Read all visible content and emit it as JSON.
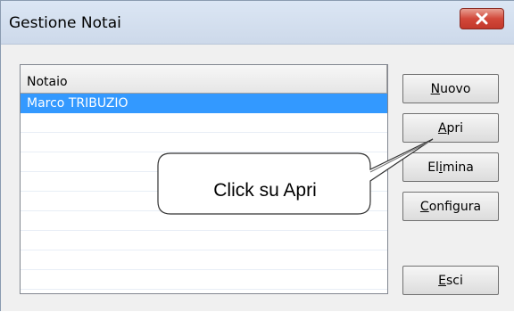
{
  "window": {
    "title": "Gestione Notai",
    "close_icon": "close-icon"
  },
  "list": {
    "column_header": "Notaio",
    "rows": [
      {
        "label": "Marco TRIBUZIO",
        "selected": true
      },
      {
        "label": ""
      },
      {
        "label": ""
      },
      {
        "label": ""
      },
      {
        "label": ""
      },
      {
        "label": ""
      },
      {
        "label": ""
      },
      {
        "label": ""
      },
      {
        "label": ""
      },
      {
        "label": ""
      }
    ]
  },
  "buttons": {
    "nuovo": {
      "mnemonic": "N",
      "rest": "uovo"
    },
    "apri": {
      "mnemonic": "A",
      "rest": "pri"
    },
    "elimina": {
      "pre": "El",
      "mnemonic": "i",
      "rest": "mina"
    },
    "configura": {
      "mnemonic": "C",
      "rest": "onfigura"
    },
    "esci": {
      "mnemonic": "E",
      "rest": "sci"
    }
  },
  "callout": {
    "text": "Click su Apri"
  },
  "colors": {
    "selection": "#3399ff",
    "close_button": "#c7483a"
  }
}
